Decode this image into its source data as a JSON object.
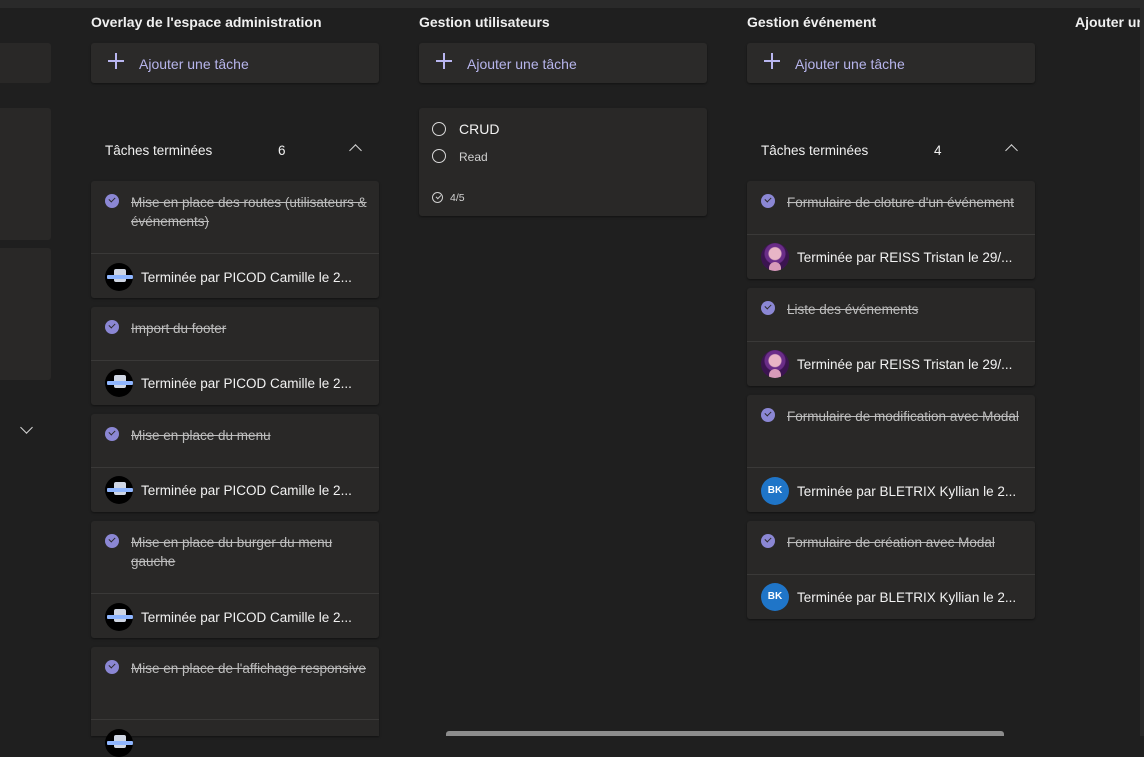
{
  "columns": [
    {
      "title": "Overlay de l'espace administration",
      "add_task_label": "Ajouter une tâche",
      "done_label": "Tâches terminées",
      "done_count": "6",
      "tasks": [
        {
          "title": "Mise en place des routes (utilisateurs & événements)",
          "completed_by": "Terminée par PICOD Camille le 2..."
        },
        {
          "title": "Import du footer",
          "completed_by": "Terminée par PICOD Camille le 2..."
        },
        {
          "title": "Mise en place du menu",
          "completed_by": "Terminée par PICOD Camille le 2..."
        },
        {
          "title": "Mise en place du burger du menu gauche",
          "completed_by": "Terminée par PICOD Camille le 2..."
        },
        {
          "title": "Mise en place de l'affichage responsive",
          "completed_by": ""
        }
      ]
    },
    {
      "title": "Gestion utilisateurs",
      "add_task_label": "Ajouter une tâche",
      "card": {
        "title": "CRUD",
        "checklist_item": "Read",
        "progress": "4/5"
      }
    },
    {
      "title": "Gestion événement",
      "add_task_label": "Ajouter une tâche",
      "done_label": "Tâches terminées",
      "done_count": "4",
      "tasks": [
        {
          "title": "Formulaire de cloture d'un événement",
          "completed_by": "Terminée par REISS Tristan le 29/..."
        },
        {
          "title": "Liste des événements",
          "completed_by": "Terminée par REISS Tristan le 29/..."
        },
        {
          "title": "Formulaire de modification avec Modal",
          "completed_by": "Terminée par BLETRIX Kyllian le 2...",
          "avatar_initials": "BK"
        },
        {
          "title": "Formulaire de création avec Modal",
          "completed_by": "Terminée par BLETRIX Kyllian le 2...",
          "avatar_initials": "BK"
        }
      ]
    },
    {
      "title": "Ajouter un"
    }
  ],
  "icons": {
    "add": "plus-icon",
    "collapse": "chevron-up-icon",
    "expand": "chevron-down-icon",
    "completed": "check-circle-icon",
    "checklist": "radio-circle-icon"
  },
  "colors": {
    "background": "#1f1f1f",
    "card": "#292827",
    "accent": "#8b87d4",
    "add_text": "#b7b5ec",
    "avatar_bk": "#1f75c8"
  }
}
